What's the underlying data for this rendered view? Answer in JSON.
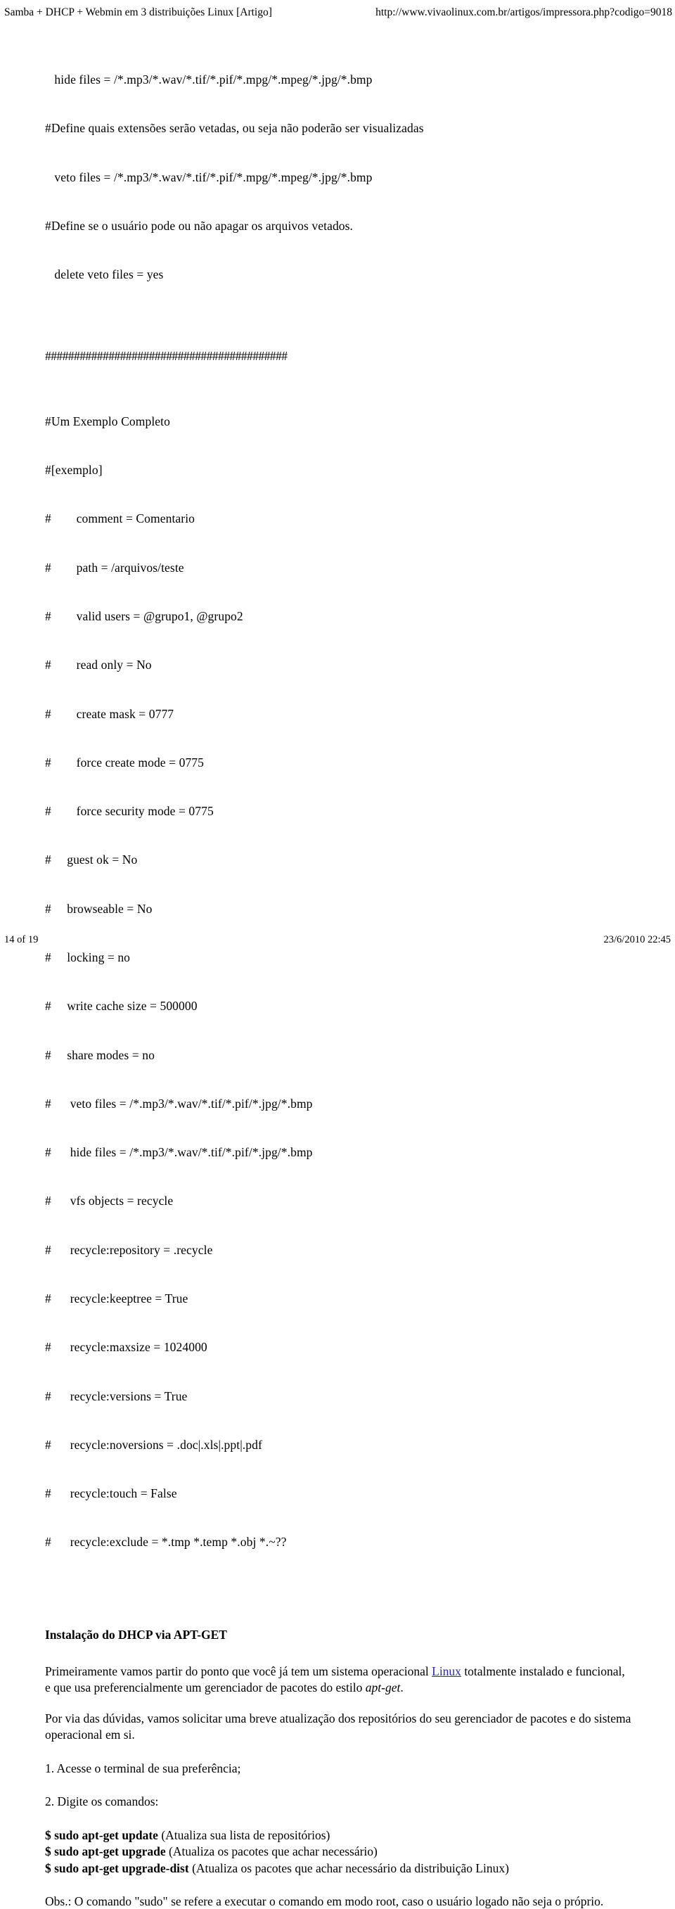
{
  "header": {
    "title": "Samba + DHCP + Webmin em 3 distribuições Linux [Artigo]",
    "url": "http://www.vivaolinux.com.br/artigos/impressora.php?codigo=9018"
  },
  "footer": {
    "page": "14 of 19",
    "timestamp": "23/6/2010 22:45"
  },
  "config_top": {
    "lines": [
      "   hide files = /*.mp3/*.wav/*.tif/*.pif/*.mpg/*.mpeg/*.jpg/*.bmp",
      "#Define quais extensões serão vetadas, ou seja não poderão ser visualizadas",
      "   veto files = /*.mp3/*.wav/*.tif/*.pif/*.mpg/*.mpeg/*.jpg/*.bmp",
      "#Define se o usuário pode ou não apagar os arquivos vetados.",
      "   delete veto files = yes"
    ]
  },
  "separator": {
    "rule": "##########################################"
  },
  "config_example": {
    "lines": [
      "#Um Exemplo Completo",
      "#[exemplo]",
      "#        comment = Comentario",
      "#        path = /arquivos/teste",
      "#        valid users = @grupo1, @grupo2",
      "#        read only = No",
      "#        create mask = 0777",
      "#        force create mode = 0775",
      "#        force security mode = 0775",
      "#     guest ok = No",
      "#     browseable = No",
      "#     locking = no",
      "#     write cache size = 500000",
      "#     share modes = no",
      "#      veto files = /*.mp3/*.wav/*.tif/*.pif/*.jpg/*.bmp",
      "#      hide files = /*.mp3/*.wav/*.tif/*.pif/*.jpg/*.bmp",
      "#      vfs objects = recycle",
      "#      recycle:repository = .recycle",
      "#      recycle:keeptree = True",
      "#      recycle:maxsize = 1024000",
      "#      recycle:versions = True",
      "#      recycle:noversions = .doc|.xls|.ppt|.pdf",
      "#      recycle:touch = False",
      "#      recycle:exclude = *.tmp *.temp *.obj *.~??"
    ]
  },
  "article": {
    "heading": "Instalação do DHCP via APT-GET",
    "para1_before": "Primeiramente vamos partir do ponto que você já tem um sistema operacional ",
    "para1_link": "Linux",
    "para1_mid": " totalmente instalado e funcional, e que usa preferencialmente um gerenciador de pacotes do estilo ",
    "para1_em": "apt-get",
    "para1_after": ".",
    "para2": "Por via das dúvidas, vamos solicitar uma breve atualização dos repositórios do seu gerenciador de pacotes e do sistema operacional em si.",
    "step1": "1. Acesse o terminal de sua preferência;",
    "step2": "2. Digite os comandos:",
    "commands": [
      {
        "cmd": "$ sudo apt-get update",
        "desc": " (Atualiza sua lista de repositórios)"
      },
      {
        "cmd": "$ sudo apt-get upgrade",
        "desc": " (Atualiza os pacotes que achar necessário)"
      },
      {
        "cmd": "$ sudo apt-get upgrade-dist",
        "desc": " (Atualiza os pacotes que achar necessário da distribuição Linux)"
      }
    ],
    "note": "Obs.: O comando \"sudo\" se refere a executar o comando em modo root, caso o usuário logado não seja o próprio."
  }
}
